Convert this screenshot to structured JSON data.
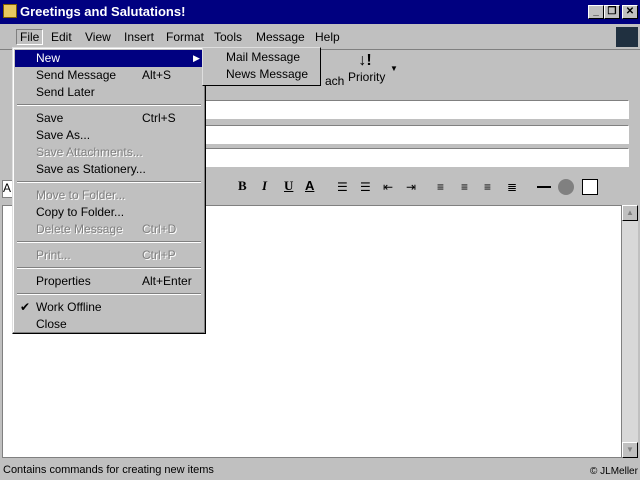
{
  "window": {
    "title": "Greetings and Salutations!",
    "minimize": "_",
    "maximize": "❐",
    "close": "✕"
  },
  "menubar": [
    "File",
    "Edit",
    "View",
    "Insert",
    "Format",
    "Tools",
    "Message",
    "Help"
  ],
  "toolbar": {
    "attach_partial": "ach",
    "priority": "Priority"
  },
  "format_toolbar": {
    "font_partial": "A",
    "bold": "B",
    "italic": "I",
    "underline": "U",
    "color": "A"
  },
  "file_menu": [
    {
      "label": "New",
      "shortcut": "",
      "state": "highlighted",
      "submenu": true
    },
    {
      "label": "Send Message",
      "shortcut": "Alt+S"
    },
    {
      "label": "Send Later",
      "shortcut": ""
    },
    {
      "label": "Save",
      "shortcut": "Ctrl+S"
    },
    {
      "label": "Save As...",
      "shortcut": ""
    },
    {
      "label": "Save Attachments...",
      "shortcut": "",
      "state": "disabled"
    },
    {
      "label": "Save as Stationery...",
      "shortcut": ""
    },
    {
      "label": "Move to Folder...",
      "shortcut": "",
      "state": "disabled"
    },
    {
      "label": "Copy to Folder...",
      "shortcut": ""
    },
    {
      "label": "Delete Message",
      "shortcut": "Ctrl+D",
      "state": "disabled"
    },
    {
      "label": "Print...",
      "shortcut": "Ctrl+P",
      "state": "disabled"
    },
    {
      "label": "Properties",
      "shortcut": "Alt+Enter"
    },
    {
      "label": "Work Offline",
      "shortcut": "",
      "checked": true
    },
    {
      "label": "Close",
      "shortcut": ""
    }
  ],
  "new_submenu": [
    "Mail Message",
    "News Message"
  ],
  "status": {
    "text": "Contains commands for creating new items",
    "credit": "© JLMeller"
  }
}
